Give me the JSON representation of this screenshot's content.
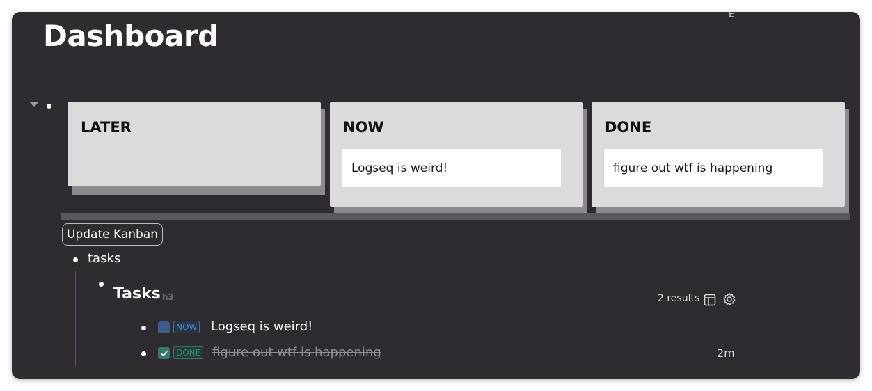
{
  "page": {
    "title": "Dashboard"
  },
  "icons": {
    "corner": "graph-icon",
    "toggle": "caret-down-icon",
    "table": "table-icon",
    "settings": "gear-icon",
    "check": "check-icon"
  },
  "colors": {
    "background": "#2e2c30",
    "column": "#dbdbdb",
    "now_accent": "#4a86cc",
    "done_accent": "#2f7a6c"
  },
  "kanban": {
    "columns": [
      {
        "title": "LATER",
        "cards": []
      },
      {
        "title": "NOW",
        "cards": [
          "Logseq is weird!"
        ]
      },
      {
        "title": "DONE",
        "cards": [
          "figure out wtf is happening"
        ]
      }
    ],
    "update_button": "Update Kanban"
  },
  "outline": {
    "tasks_block": "tasks",
    "query": {
      "heading": "Tasks",
      "heading_level": "h3",
      "results": "2 results",
      "items": [
        {
          "marker": "NOW",
          "text": "Logseq is weird!",
          "checked": false,
          "time": ""
        },
        {
          "marker": "DONE",
          "text": "figure out wtf is happening",
          "checked": true,
          "time": "2m"
        }
      ]
    }
  }
}
